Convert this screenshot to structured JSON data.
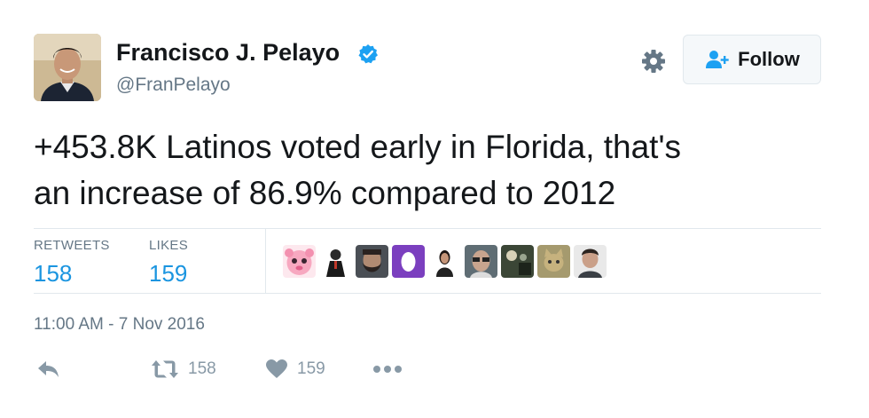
{
  "user": {
    "name": "Francisco J. Pelayo",
    "handle": "@FranPelayo"
  },
  "follow_button": {
    "label": "Follow"
  },
  "tweet": {
    "text_line1": "+453.8K Latinos voted early in Florida, that's",
    "text_line2": "an increase of 86.9% compared to 2012"
  },
  "stats": {
    "retweets_label": "RETWEETS",
    "retweets_count": "158",
    "likes_label": "LIKES",
    "likes_count": "159"
  },
  "likers": [
    {
      "icon": "pink-character-avatar"
    },
    {
      "icon": "person-dark-avatar"
    },
    {
      "icon": "bearded-man-avatar"
    },
    {
      "icon": "purple-egg-avatar"
    },
    {
      "icon": "woman-avatar"
    },
    {
      "icon": "man-glasses-avatar"
    },
    {
      "icon": "scene-avatar"
    },
    {
      "icon": "cat-avatar"
    },
    {
      "icon": "man-avatar"
    }
  ],
  "timestamp": "11:00 AM - 7 Nov 2016",
  "actions": {
    "reply_icon": "reply-icon",
    "retweet_count": "158",
    "like_count": "159",
    "more_icon": "more-icon"
  },
  "colors": {
    "link_blue": "#1b95e0",
    "verified_blue": "#1da1f2",
    "muted_gray": "#657786",
    "action_gray": "#8899a6",
    "divider": "#e1e8ed"
  }
}
